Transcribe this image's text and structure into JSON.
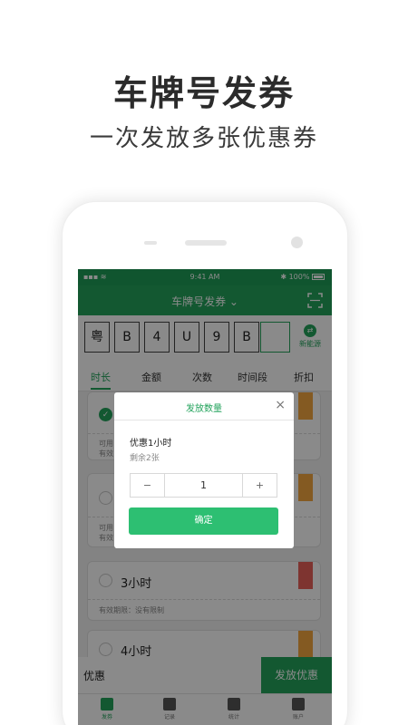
{
  "promo": {
    "title": "车牌号发券",
    "subtitle": "一次发放多张优惠券"
  },
  "status_bar": {
    "signal": "▪▪▪ ≋",
    "time": "9:41 AM",
    "battery": "✱ 100%"
  },
  "navbar": {
    "title": "车牌号发券 ⌄",
    "scan_icon": "scan-icon"
  },
  "plate": {
    "chars": [
      "粤",
      "B",
      "4",
      "U",
      "9",
      "B",
      ""
    ],
    "new_energy_label": "新能源"
  },
  "tabs": [
    "时长",
    "金额",
    "次数",
    "时间段",
    "折扣"
  ],
  "active_tab": 0,
  "cards": [
    {
      "name": "",
      "meta_lines": [
        "可用",
        "有效"
      ],
      "checked": true,
      "ribbon": "orange"
    },
    {
      "name": "",
      "meta_lines": [
        "可用",
        "有效"
      ],
      "checked": false,
      "ribbon": "orange"
    },
    {
      "name": "3小时",
      "meta_lines": [
        "有效期限：没有限制"
      ],
      "checked": false,
      "ribbon": "red"
    },
    {
      "name": "4小时",
      "meta_lines": [],
      "checked": false,
      "ribbon": "orange"
    }
  ],
  "bottom_bar": {
    "label": "优惠",
    "issue_button": "发放优惠"
  },
  "tabbar": [
    {
      "label": "发券",
      "active": true
    },
    {
      "label": "记录",
      "active": false
    },
    {
      "label": "统计",
      "active": false
    },
    {
      "label": "账户",
      "active": false
    }
  ],
  "dialog": {
    "title": "发放数量",
    "close": "×",
    "coupon_name": "优惠1小时",
    "remaining": "剩余2张",
    "minus": "−",
    "quantity": "1",
    "plus": "+",
    "confirm": "确定"
  },
  "colors": {
    "brand_green": "#23a35c",
    "confirm_green": "#2dbf72",
    "ribbon_orange": "#f4a640",
    "ribbon_red": "#e9605a"
  }
}
